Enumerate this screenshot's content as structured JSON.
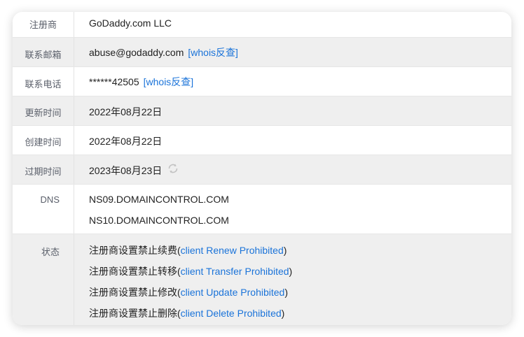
{
  "rows": {
    "registrar": {
      "label": "注册商",
      "value": "GoDaddy.com LLC"
    },
    "email": {
      "label": "联系邮箱",
      "value": "abuse@godaddy.com",
      "link": "[whois反查]"
    },
    "phone": {
      "label": "联系电话",
      "value": "******42505",
      "link": "[whois反查]"
    },
    "updated": {
      "label": "更新时间",
      "value": "2022年08月22日"
    },
    "created": {
      "label": "创建时间",
      "value": "2022年08月22日"
    },
    "expires": {
      "label": "过期时间",
      "value": "2023年08月23日",
      "icon": "refresh-icon"
    },
    "dns": {
      "label": "DNS",
      "values": [
        "NS09.DOMAINCONTROL.COM",
        "NS10.DOMAINCONTROL.COM"
      ]
    },
    "status": {
      "label": "状态",
      "items": [
        {
          "prefix": "注册商设置禁止续费(",
          "code": "client Renew Prohibited",
          "suffix": ")"
        },
        {
          "prefix": "注册商设置禁止转移(",
          "code": "client Transfer Prohibited",
          "suffix": ")"
        },
        {
          "prefix": "注册商设置禁止修改(",
          "code": "client Update Prohibited",
          "suffix": ")"
        },
        {
          "prefix": "注册商设置禁止删除(",
          "code": "client Delete Prohibited",
          "suffix": ")"
        }
      ]
    }
  },
  "colors": {
    "link": "#1a73d9",
    "label": "#5a5f6a",
    "shaded_row": "#efefef"
  }
}
